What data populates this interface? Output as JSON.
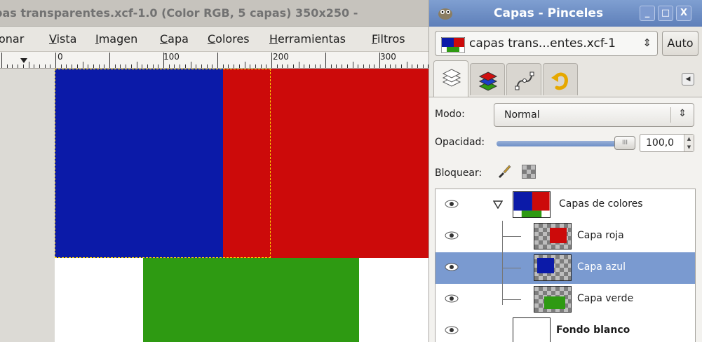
{
  "image_window": {
    "title": "pas transparentes.xcf-1.0 (Color RGB, 5 capas) 350x250 -",
    "menu": [
      {
        "pre": "",
        "u": "",
        "post": "onar"
      },
      {
        "pre": "",
        "u": "V",
        "post": "ista"
      },
      {
        "pre": "",
        "u": "I",
        "post": "magen"
      },
      {
        "pre": "",
        "u": "C",
        "post": "apa"
      },
      {
        "pre": "",
        "u": "C",
        "post": "olores"
      },
      {
        "pre": "",
        "u": "H",
        "post": "erramientas"
      },
      {
        "pre": "",
        "u": "F",
        "post": "iltros"
      }
    ],
    "ruler_labels": [
      "0",
      "100",
      "200",
      "300"
    ],
    "colors": {
      "blue": "#0b1aa8",
      "red": "#cc0a0a",
      "green": "#2e9a12",
      "white": "#ffffff"
    }
  },
  "dock": {
    "title": "Capas - Pinceles",
    "window_buttons": [
      "_",
      "□",
      "X"
    ],
    "image_combo": "capas trans...entes.xcf-1",
    "auto_label": "Auto",
    "tab_icons": [
      "layers-icon",
      "channels-icon",
      "paths-icon",
      "undo-history-icon"
    ],
    "mode_label": "Modo:",
    "mode_value": "Normal",
    "opacity_label": "Opacidad:",
    "opacity_value": "100,0",
    "opacity_percent": 100,
    "lock_label": "Bloquear:",
    "layers": [
      {
        "name": "Capas de colores",
        "visible": true,
        "group": true,
        "selected": false,
        "bold": false
      },
      {
        "name": "Capa roja",
        "visible": true,
        "group": false,
        "selected": false,
        "bold": false
      },
      {
        "name": "Capa azul",
        "visible": true,
        "group": false,
        "selected": true,
        "bold": false
      },
      {
        "name": "Capa verde",
        "visible": true,
        "group": false,
        "selected": false,
        "bold": false
      },
      {
        "name": "Fondo blanco",
        "visible": true,
        "group": false,
        "selected": false,
        "bold": true
      }
    ]
  }
}
